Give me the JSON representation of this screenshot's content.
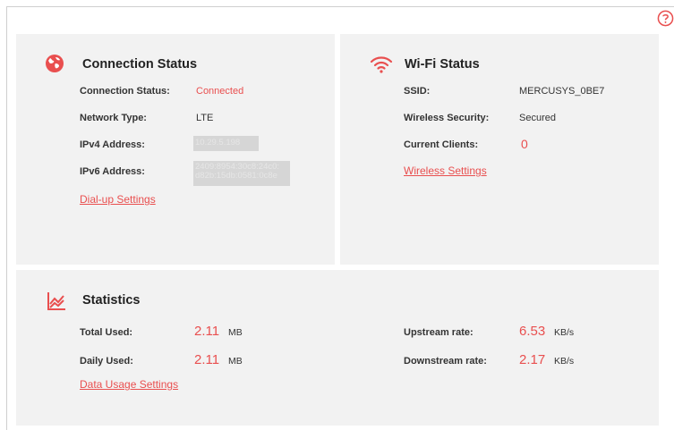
{
  "connection": {
    "title": "Connection Status",
    "rows": [
      {
        "label": "Connection Status:",
        "value": "Connected"
      },
      {
        "label": "Network Type:",
        "value": "LTE"
      },
      {
        "label": "IPv4 Address:",
        "value": "10.29.5.198"
      },
      {
        "label": "IPv6 Address:",
        "value": "2409:8954:30c8:24c0:",
        "value2": "d82b:15db:0581:0c8e"
      }
    ],
    "link": "Dial-up Settings"
  },
  "wifi": {
    "title": "Wi-Fi Status",
    "rows": [
      {
        "label": "SSID:",
        "value": "MERCUSYS_0BE7"
      },
      {
        "label": "Wireless Security:",
        "value": "Secured"
      },
      {
        "label": "Current Clients:",
        "value": "0"
      }
    ],
    "link": "Wireless Settings"
  },
  "stats": {
    "title": "Statistics",
    "total_used": {
      "label": "Total Used:",
      "value": "2.11",
      "unit": "MB"
    },
    "daily_used": {
      "label": "Daily Used:",
      "value": "2.11",
      "unit": "MB"
    },
    "upstream": {
      "label": "Upstream rate:",
      "value": "6.53",
      "unit": "KB/s"
    },
    "downstream": {
      "label": "Downstream rate:",
      "value": "2.17",
      "unit": "KB/s"
    },
    "link": "Data Usage Settings"
  },
  "icons": {
    "help": "help-circle-icon",
    "connection": "globe-icon",
    "wifi": "wifi-icon",
    "stats": "chart-icon"
  },
  "colors": {
    "accent": "#e94f4f",
    "card_bg": "#f2f2f2"
  }
}
